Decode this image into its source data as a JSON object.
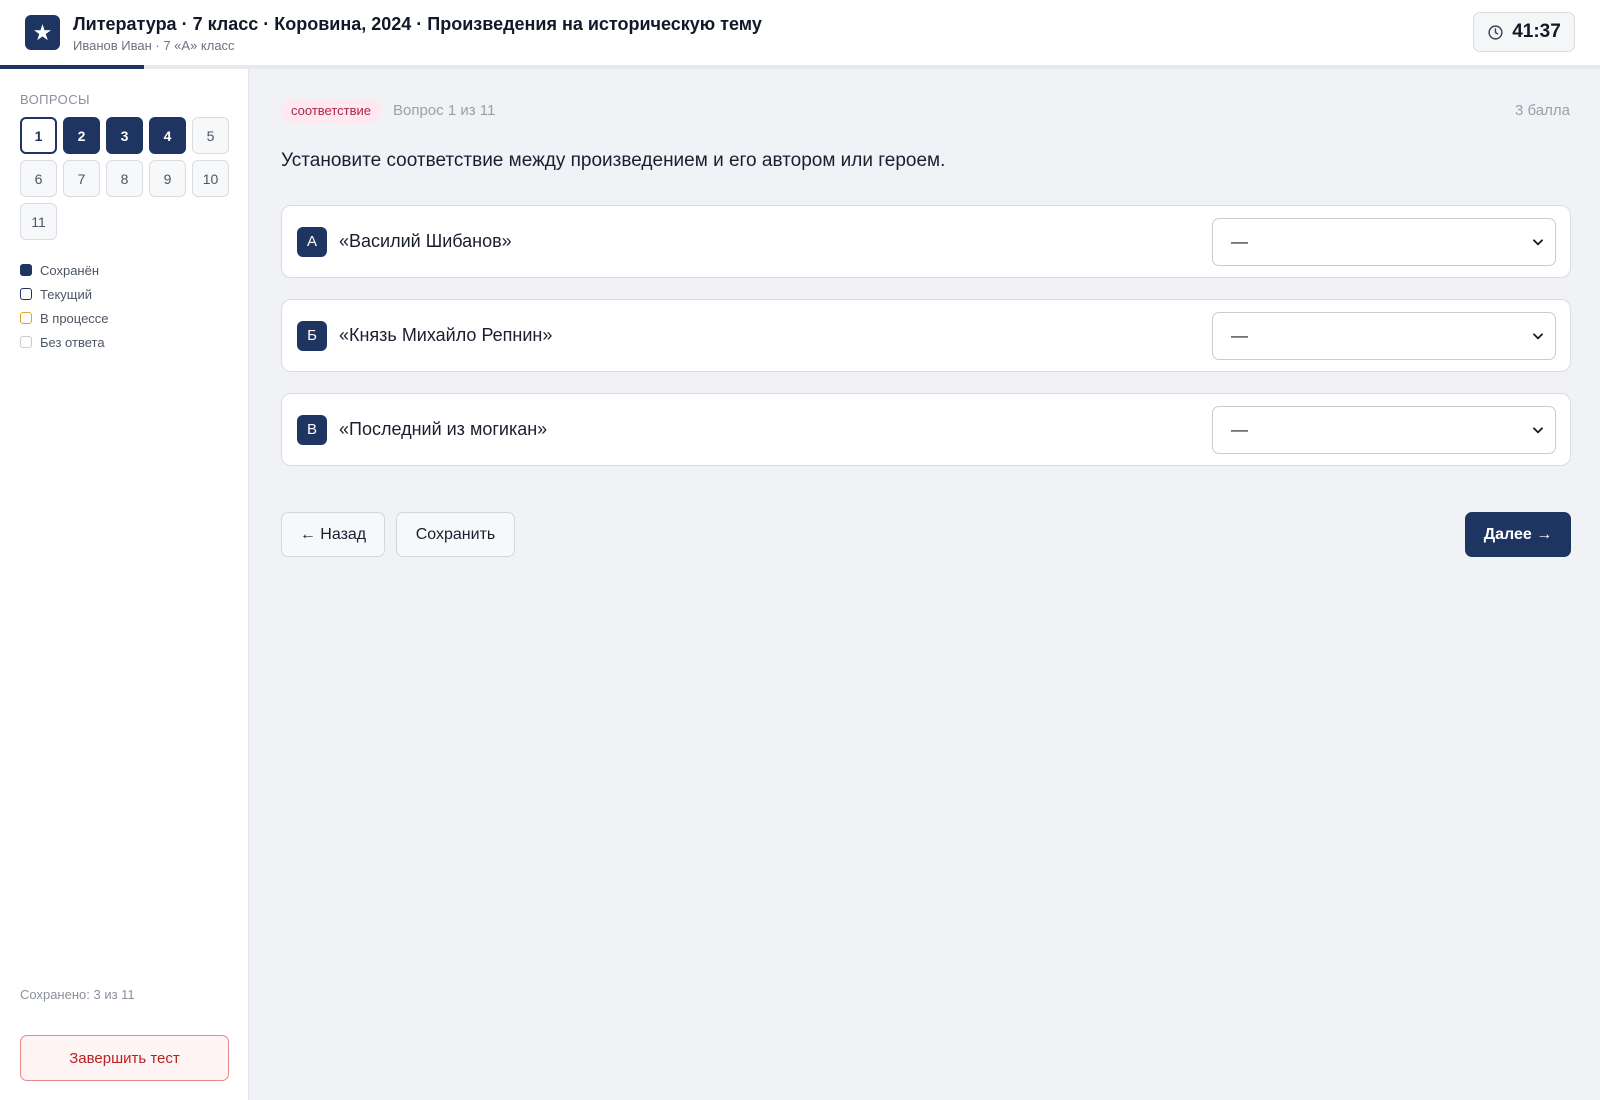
{
  "header": {
    "logo_glyph": "★",
    "title": "Литература · 7 класс · Коровина, 2024 · Произведения на историческую тему",
    "subtitle": "Иванов Иван · 7 «А» класс",
    "timer": "41:37",
    "progress_fraction": 0.09
  },
  "sidebar": {
    "heading": "ВОПРОСЫ",
    "questions": [
      {
        "n": "1",
        "state": "current"
      },
      {
        "n": "2",
        "state": "saved"
      },
      {
        "n": "3",
        "state": "saved"
      },
      {
        "n": "4",
        "state": "saved"
      },
      {
        "n": "5",
        "state": "empty"
      },
      {
        "n": "6",
        "state": "empty"
      },
      {
        "n": "7",
        "state": "empty"
      },
      {
        "n": "8",
        "state": "empty"
      },
      {
        "n": "9",
        "state": "empty"
      },
      {
        "n": "10",
        "state": "empty"
      },
      {
        "n": "11",
        "state": "empty"
      }
    ],
    "legend": [
      {
        "label": "Сохранён",
        "kind": "saved"
      },
      {
        "label": "Текущий",
        "kind": "current"
      },
      {
        "label": "В процессе",
        "kind": "progress"
      },
      {
        "label": "Без ответа",
        "kind": "noanswer"
      }
    ],
    "saved_count": "Сохранено: 3 из 11",
    "finish_label": "Завершить тест"
  },
  "question": {
    "type_badge": "соответствие",
    "counter": "Вопрос 1 из 11",
    "points": "3 балла",
    "text": "Установите соответствие между произведением и его автором или героем.",
    "rows": [
      {
        "letter": "А",
        "text": "«Василий Шибанов»",
        "selected": "—"
      },
      {
        "letter": "Б",
        "text": "«Князь Михайло Репнин»",
        "selected": "—"
      },
      {
        "letter": "В",
        "text": "«Последний из могикан»",
        "selected": "—"
      }
    ]
  },
  "nav": {
    "back_label": "← Назад",
    "save_label": "Сохранить",
    "next_label": "Далее →"
  },
  "colors": {
    "accent": "#1e3461",
    "badge_bg": "#fde9ef",
    "badge_text": "#b0234f",
    "danger": "#b42323",
    "in_progress": "#e0a527"
  }
}
